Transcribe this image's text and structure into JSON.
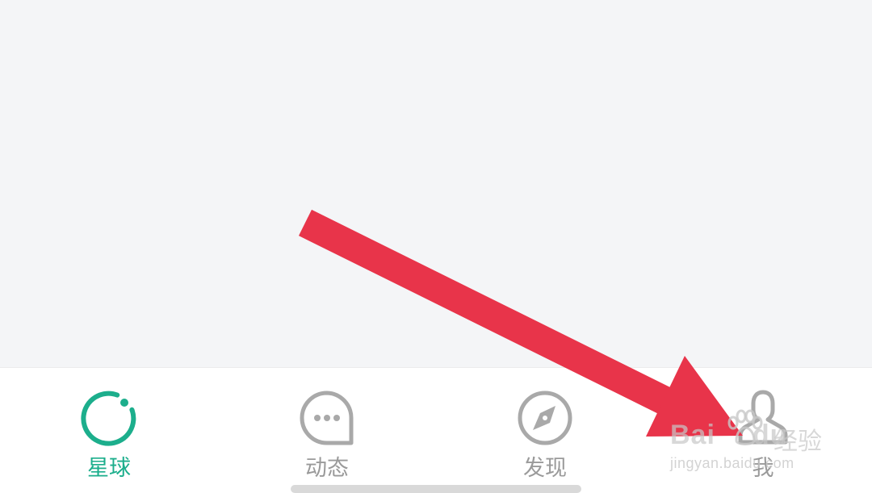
{
  "tabs": [
    {
      "label": "星球",
      "icon": "planet-icon",
      "active": true
    },
    {
      "label": "动态",
      "icon": "chat-bubble-icon",
      "active": false
    },
    {
      "label": "发现",
      "icon": "compass-icon",
      "active": false
    },
    {
      "label": "我",
      "icon": "person-icon",
      "active": false
    }
  ],
  "colors": {
    "active": "#1cae8c",
    "inactive": "#a9a9a9",
    "arrow": "#e8344a",
    "background": "#f4f5f7"
  },
  "watermark": {
    "brand": "Bai",
    "brand_suffix": "du",
    "cn": "经验",
    "url": "jingyan.baidu.com"
  }
}
